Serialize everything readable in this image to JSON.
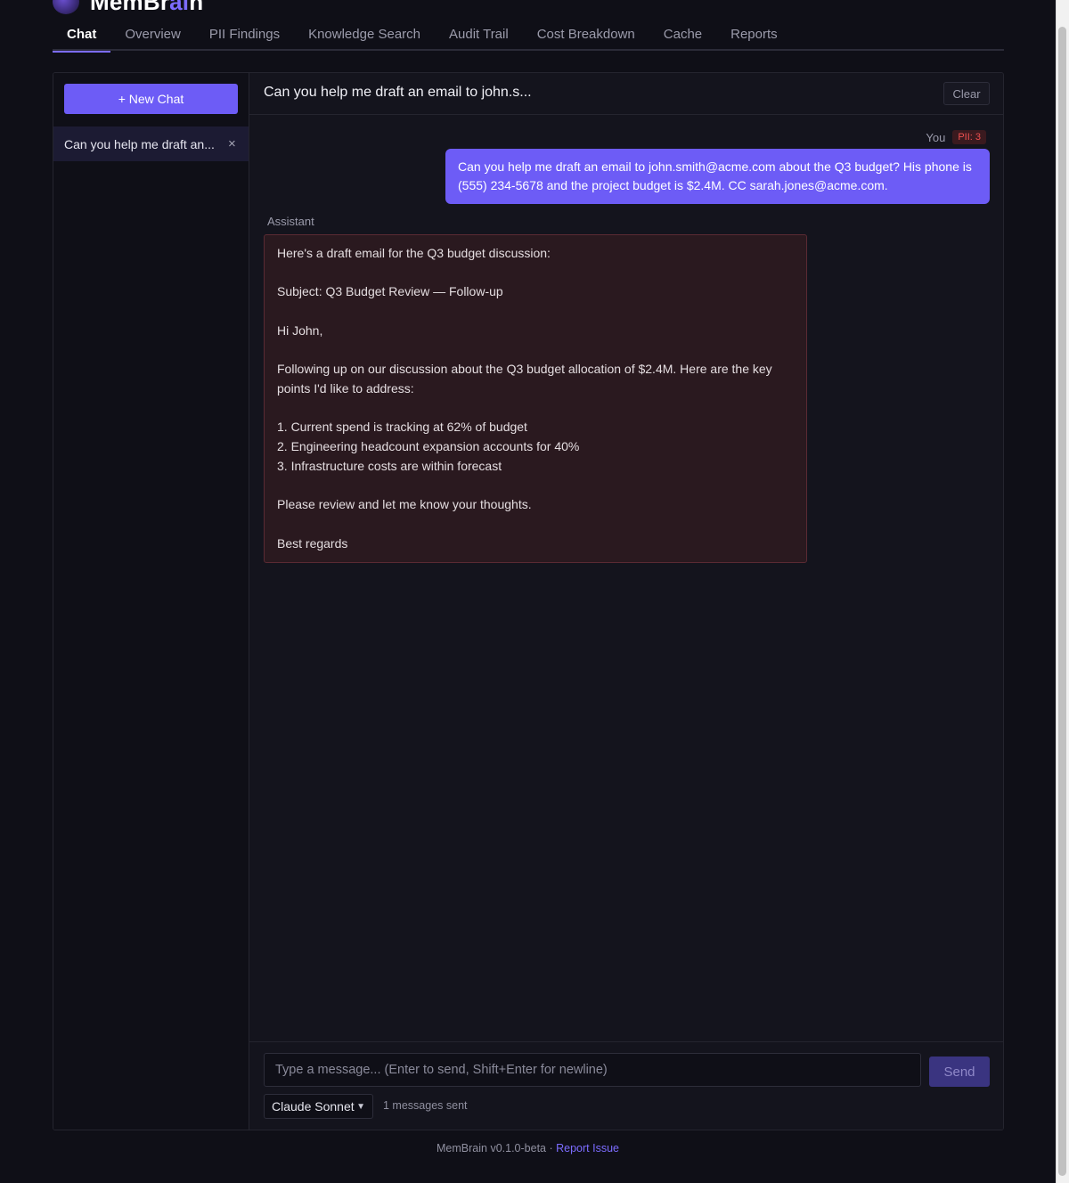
{
  "brand": {
    "name_prefix": "MemBr",
    "name_ai": "ai",
    "name_suffix": "n"
  },
  "nav": {
    "tabs": [
      {
        "label": "Chat",
        "active": true
      },
      {
        "label": "Overview"
      },
      {
        "label": "PII Findings"
      },
      {
        "label": "Knowledge Search"
      },
      {
        "label": "Audit Trail"
      },
      {
        "label": "Cost Breakdown"
      },
      {
        "label": "Cache"
      },
      {
        "label": "Reports"
      }
    ]
  },
  "sidebar": {
    "new_chat_label": "+ New Chat",
    "chats": [
      {
        "label": "Can you help me draft an...",
        "close": "×"
      }
    ]
  },
  "chat": {
    "title": "Can you help me draft an email to john.s...",
    "clear_label": "Clear",
    "user_label": "You",
    "pii_badge": "PII: 3",
    "user_message": "Can you help me draft an email to john.smith@acme.com about the Q3 budget? His phone is (555) 234-5678 and the project budget is $2.4M. CC sarah.jones@acme.com.",
    "assistant_label": "Assistant",
    "assistant_message": "Here's a draft email for the Q3 budget discussion:\n\nSubject: Q3 Budget Review — Follow-up\n\nHi John,\n\nFollowing up on our discussion about the Q3 budget allocation of $2.4M. Here are the key points I'd like to address:\n\n1. Current spend is tracking at 62% of budget\n2. Engineering headcount expansion accounts for 40%\n3. Infrastructure costs are within forecast\n\nPlease review and let me know your thoughts.\n\nBest regards"
  },
  "composer": {
    "placeholder": "Type a message... (Enter to send, Shift+Enter for newline)",
    "send_label": "Send",
    "model_selected": "Claude Sonnet",
    "message_count": "1 messages sent"
  },
  "footer": {
    "version": "MemBrain v0.1.0-beta · ",
    "report_link": "Report Issue"
  },
  "colors": {
    "accent": "#6d5cf6",
    "pii": "#f05050",
    "background": "#0f0f17"
  }
}
